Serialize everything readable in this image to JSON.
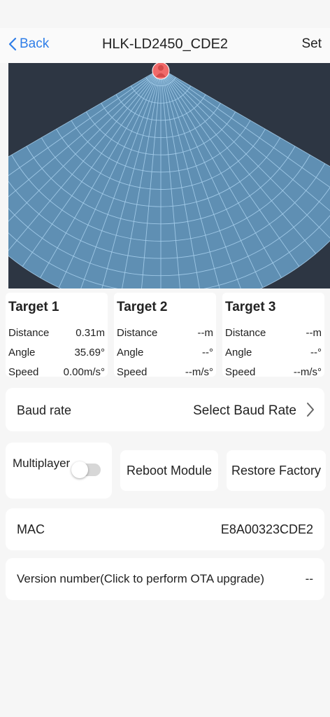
{
  "header": {
    "back_label": "Back",
    "title": "HLK-LD2450_CDE2",
    "set_label": "Set"
  },
  "radar": {
    "background_color": "#2d3643",
    "field_color": "#5f8fb3",
    "grid_color": "#a9d1ee",
    "target_color": "#f06a6a",
    "fov_degrees": 120
  },
  "targets": [
    {
      "name": "Target 1",
      "distance_label": "Distance",
      "distance": "0.31m",
      "angle_label": "Angle",
      "angle": "35.69°",
      "speed_label": "Speed",
      "speed": "0.00m/s°"
    },
    {
      "name": "Target 2",
      "distance_label": "Distance",
      "distance": "--m",
      "angle_label": "Angle",
      "angle": "--°",
      "speed_label": "Speed",
      "speed": "--m/s°"
    },
    {
      "name": "Target 3",
      "distance_label": "Distance",
      "distance": "--m",
      "angle_label": "Angle",
      "angle": "--°",
      "speed_label": "Speed",
      "speed": "--m/s°"
    }
  ],
  "baud": {
    "label": "Baud rate",
    "value": "Select Baud Rate"
  },
  "controls": {
    "multiplayer_label": "Multiplayer",
    "multiplayer_on": false,
    "reboot_label": "Reboot Module",
    "restore_label": "Restore Factory"
  },
  "mac": {
    "label": "MAC",
    "value": "E8A00323CDE2"
  },
  "version": {
    "label": "Version number(Click to perform OTA upgrade)",
    "value": "--"
  },
  "colors": {
    "accent": "#2f7ee8"
  }
}
